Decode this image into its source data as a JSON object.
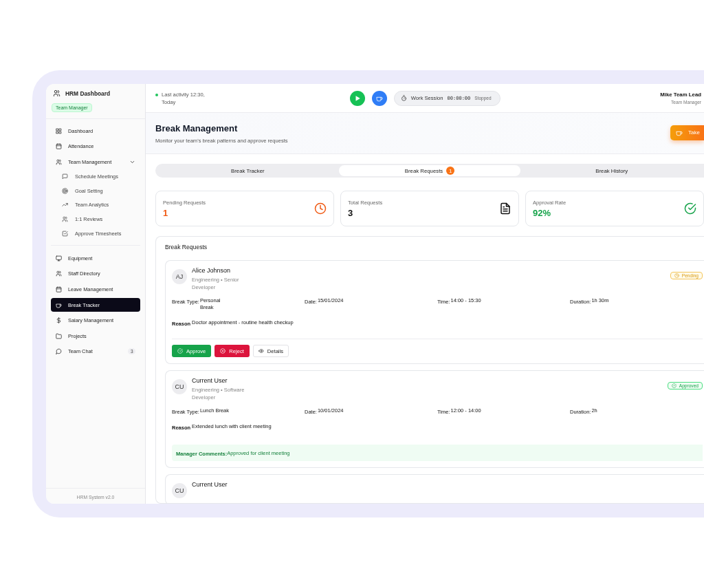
{
  "sidebar": {
    "title": "HRM Dashboard",
    "role_badge": "Team Manager",
    "items": [
      {
        "label": "Dashboard",
        "selected": false
      },
      {
        "label": "Attendance",
        "selected": false
      },
      {
        "label": "Team Management",
        "selected": false,
        "expanded": true,
        "children": [
          {
            "label": "Schedule Meetings",
            "selected": false
          },
          {
            "label": "Goal Setting",
            "selected": false
          },
          {
            "label": "Team Analytics",
            "selected": false
          },
          {
            "label": "1:1 Reviews",
            "selected": false
          },
          {
            "label": "Approve Timesheets",
            "selected": false
          }
        ]
      },
      {
        "label": "Equipment",
        "selected": false
      },
      {
        "label": "Staff Directory",
        "selected": false
      },
      {
        "label": "Leave Management",
        "selected": false
      },
      {
        "label": "Break Tracker",
        "selected": true
      },
      {
        "label": "Salary Management",
        "selected": false
      },
      {
        "label": "Projects",
        "selected": false
      },
      {
        "label": "Team Chat",
        "selected": false,
        "badge": "3"
      }
    ],
    "footer": "HRM System v2.0"
  },
  "topbar": {
    "activity": "Last activity 12:30, Today",
    "session": {
      "label": "Work Session",
      "timer": "00:00:00",
      "status": "Stopped"
    },
    "user": {
      "name": "Mike Team Lead",
      "role": "Team Manager"
    }
  },
  "header": {
    "title": "Break Management",
    "subtitle": "Monitor your team's break patterns and approve requests",
    "action": "Take"
  },
  "tabs": [
    {
      "label": "Break Tracker",
      "selected": false
    },
    {
      "label": "Break Requests",
      "selected": true,
      "badge": "1"
    },
    {
      "label": "Break History",
      "selected": false
    }
  ],
  "stats": [
    {
      "label": "Pending Requests",
      "value": "1",
      "color": "#f05a14"
    },
    {
      "label": "Total Requests",
      "value": "3",
      "color": "#111111"
    },
    {
      "label": "Approval Rate",
      "value": "92%",
      "color": "#16a34a"
    }
  ],
  "requests": {
    "title": "Break Requests",
    "items": [
      {
        "initials": "AJ",
        "name": "Alice Johnson",
        "department": "Engineering • Senior Developer",
        "status": {
          "label": "Pending",
          "kind": "pending"
        },
        "fields": [
          {
            "label": "Break Type:",
            "value": "Personal Break"
          },
          {
            "label": "Date:",
            "value": "15/01/2024"
          },
          {
            "label": "Time:",
            "value": "14:00 - 15:30"
          },
          {
            "label": "Duration:",
            "value": "1h 30m"
          }
        ],
        "reason": {
          "label": "Reason",
          "value": "Doctor appointment - routine health checkup"
        },
        "actions": [
          {
            "label": "Approve",
            "kind": "approve"
          },
          {
            "label": "Reject",
            "kind": "reject"
          },
          {
            "label": "Details",
            "kind": "details"
          }
        ]
      },
      {
        "initials": "CU",
        "name": "Current User",
        "department": "Engineering • Software Developer",
        "status": {
          "label": "Approved",
          "kind": "approved"
        },
        "fields": [
          {
            "label": "Break Type:",
            "value": "Lunch Break"
          },
          {
            "label": "Date:",
            "value": "10/01/2024"
          },
          {
            "label": "Time:",
            "value": "12:00 - 14:00"
          },
          {
            "label": "Duration:",
            "value": "2h"
          }
        ],
        "reason": {
          "label": "Reason",
          "value": "Extended lunch with client meeting"
        },
        "manager_comments": {
          "label": "Manager Comments:",
          "text": "Approved for client meeting"
        }
      },
      {
        "initials": "CU",
        "name": "Current User"
      }
    ]
  }
}
